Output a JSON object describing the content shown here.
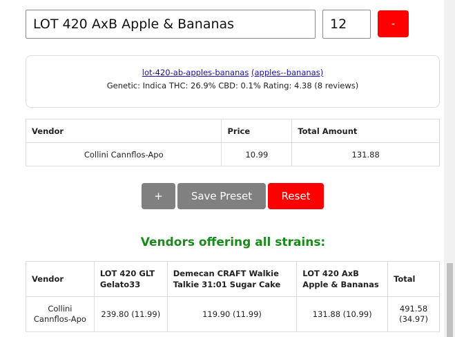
{
  "strain_input": {
    "value": "LOT 420 AxB Apple & Bananas"
  },
  "quantity_input": {
    "value": "12"
  },
  "remove_button": {
    "label": "-"
  },
  "info": {
    "slug_link": "lot-420-ab-apples-bananas",
    "category_link": "(apples--bananas)",
    "details": "Genetic: Indica THC: 26.9% CBD: 0.1% Rating: 4.38 (8 reviews)"
  },
  "vendor_table": {
    "headers": [
      "Vendor",
      "Price",
      "Total Amount"
    ],
    "rows": [
      [
        "Collini Cannflos-Apo",
        "10.99",
        "131.88"
      ]
    ]
  },
  "actions": {
    "add_label": "+",
    "save_preset_label": "Save Preset",
    "reset_label": "Reset"
  },
  "all_strains": {
    "heading": "Vendors offering all strains:",
    "headers": [
      "Vendor",
      "LOT 420 GLT Gelato33",
      "Demecan CRAFT Walkie Talkie 31:01 Sugar Cake",
      "LOT 420 AxB Apple & Bananas",
      "Total"
    ],
    "rows": [
      [
        "Collini Cannflos-Apo",
        "239.80 (11.99)",
        "119.90 (11.99)",
        "131.88 (10.99)",
        "491.58 (34.97)"
      ]
    ]
  },
  "colors": {
    "danger": "#ff0000",
    "neutral_button": "#808080",
    "heading_green": "#1a8a1a",
    "link": "#1a0dab"
  }
}
